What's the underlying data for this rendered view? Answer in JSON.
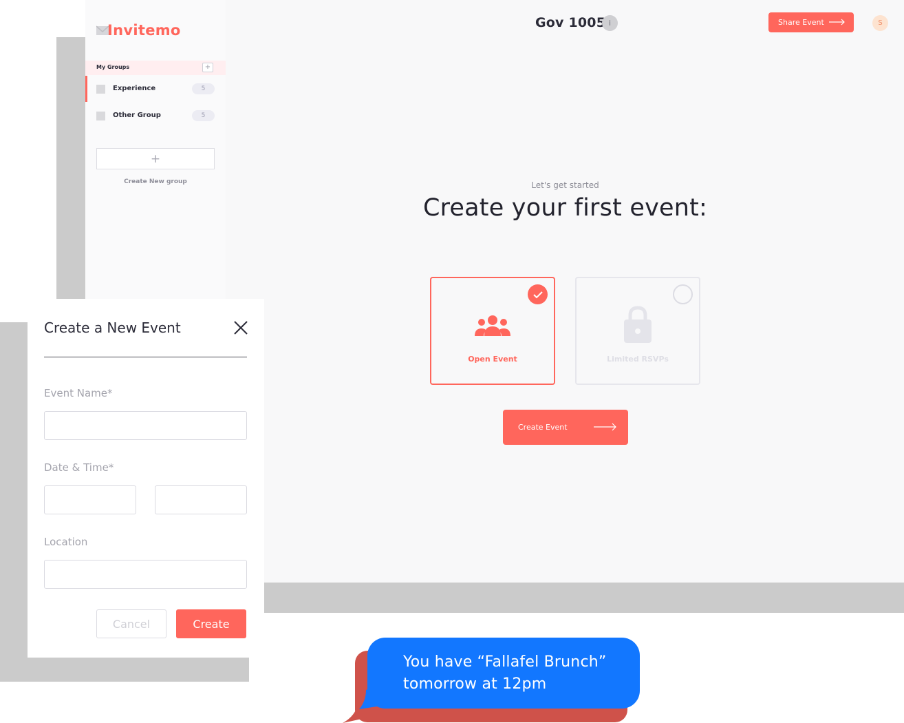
{
  "header": {
    "event_title": "Gov 1005",
    "info_label": "i",
    "share_button": "Share Event",
    "avatar_initial": "S"
  },
  "sidebar": {
    "logo": "Invitemo",
    "groups_title": "My Groups",
    "groups_add": "+",
    "groups": [
      {
        "name": "Experience",
        "count": "5"
      },
      {
        "name": "Other Group",
        "count": "5"
      }
    ],
    "new_group_plus": "+",
    "new_group_label": "Create New group"
  },
  "main": {
    "kicker": "Let's get started",
    "headline": "Create your first event:",
    "options": [
      {
        "label": "Open Event",
        "selected": true
      },
      {
        "label": "Limited RSVPs",
        "selected": false
      }
    ],
    "create_button": "Create Event"
  },
  "modal": {
    "title": "Create a New Event",
    "fields": {
      "event_name_label": "Event Name*",
      "date_time_label": "Date & Time*",
      "location_label": "Location"
    },
    "cancel_button": "Cancel",
    "create_button": "Create"
  },
  "notification": {
    "line1": "You have “Fallafel Brunch”",
    "line2": "tomorrow at 12pm"
  },
  "colors": {
    "accent": "#ff665c",
    "bubble": "#1277ff"
  }
}
